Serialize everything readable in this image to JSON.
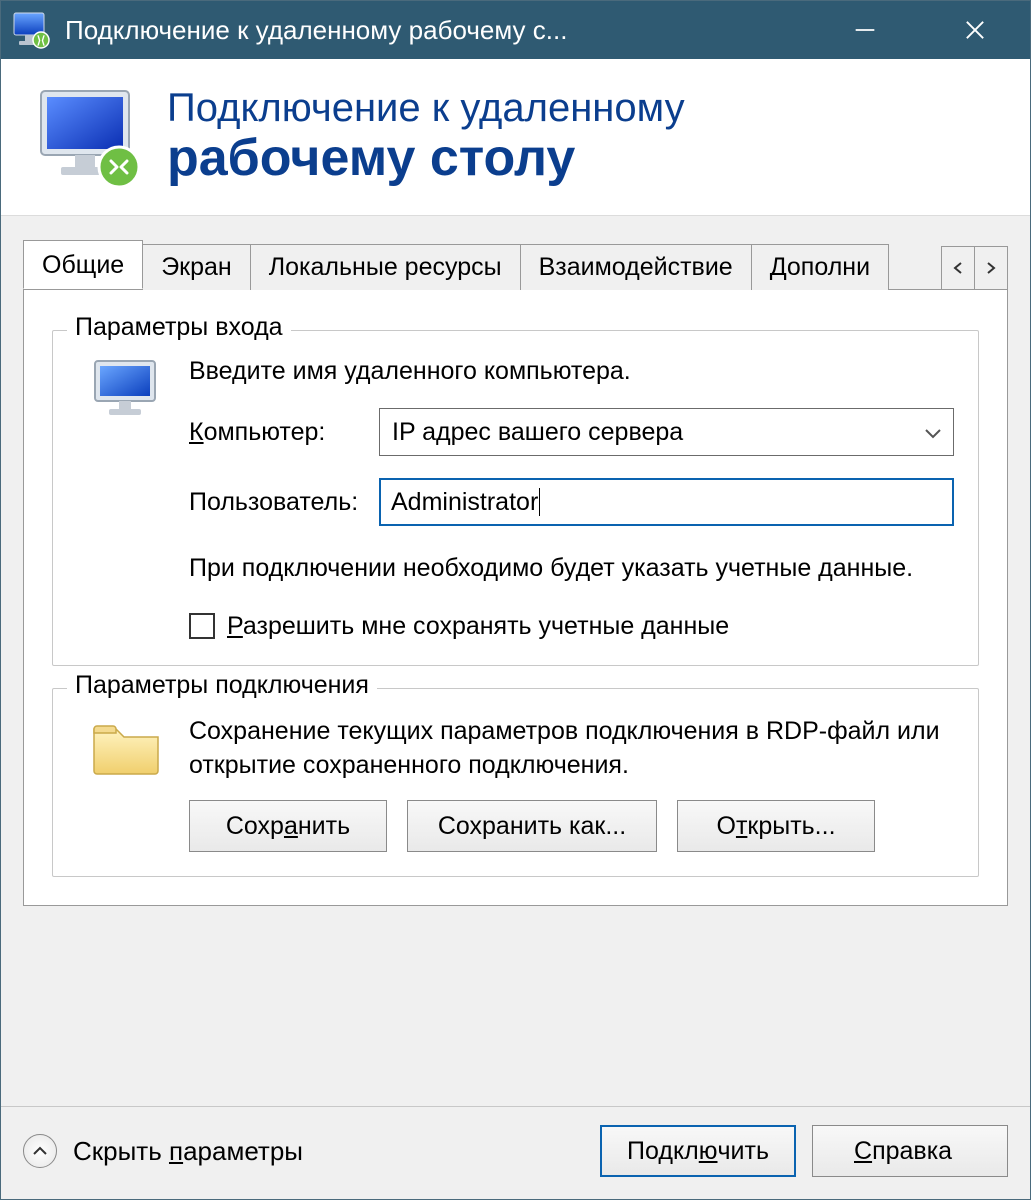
{
  "titlebar": {
    "title": "Подключение к удаленному рабочему с..."
  },
  "banner": {
    "line1": "Подключение к удаленному",
    "line2": "рабочему столу"
  },
  "tabs": {
    "items": [
      "Общие",
      "Экран",
      "Локальные ресурсы",
      "Взаимодействие",
      "Дополни"
    ]
  },
  "login_group": {
    "legend": "Параметры входа",
    "instruction": "Введите имя удаленного компьютера.",
    "computer_label_pre": "К",
    "computer_label_rest": "омпьютер:",
    "computer_value": "IP адрес вашего сервера",
    "user_label": "Пользователь:",
    "user_value": "Administrator",
    "note": "При подключении необходимо будет указать учетные данные.",
    "allow_save_pre": "Р",
    "allow_save_rest": "азрешить мне сохранять учетные данные"
  },
  "conn_group": {
    "legend": "Параметры подключения",
    "description": "Сохранение текущих параметров подключения в RDP-файл или открытие сохраненного подключения.",
    "save_pre": "Сохр",
    "save_u": "а",
    "save_post": "нить",
    "saveas_label": "Сохранить как...",
    "open_pre": "О",
    "open_u": "т",
    "open_post": "крыть..."
  },
  "footer": {
    "toggle_pre": "Скрыть ",
    "toggle_u": "п",
    "toggle_post": "араметры",
    "connect_pre": "Подкл",
    "connect_u": "ю",
    "connect_post": "чить",
    "help_pre": "С",
    "help_u": "п",
    "help_post": "равка"
  }
}
